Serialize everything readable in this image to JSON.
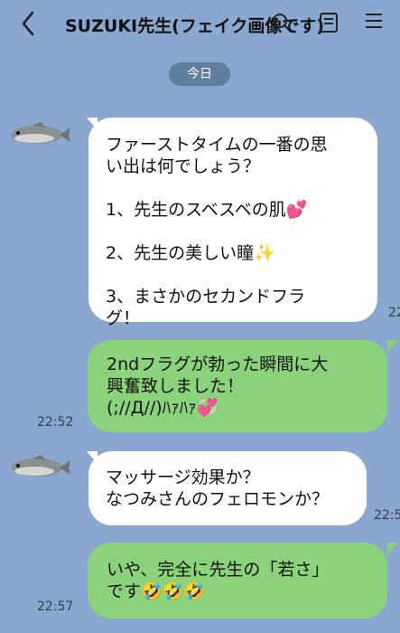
{
  "header": {
    "title": "SUZUKI先生(フェイク画像です)"
  },
  "date_label": "今日",
  "messages": [
    {
      "side": "in",
      "lines": [
        "ファーストタイムの一番の思",
        "い出は何でしょう？",
        "",
        "1、先生のスベスベの肌💕",
        "",
        "2、先生の美しい瞳✨",
        "",
        "3、まさかのセカンドフラ",
        "グ！"
      ],
      "time": "22"
    },
    {
      "side": "out",
      "lines": [
        "2ndフラグが勃った瞬間に大",
        "興奮致しました！",
        "(;//Д//)ﾊｧﾊｧ💞"
      ],
      "time": "22:52"
    },
    {
      "side": "in",
      "lines": [
        "マッサージ効果か？",
        "なつみさんのフェロモンか？"
      ],
      "time": "22:5"
    },
    {
      "side": "out",
      "lines": [
        "いや、完全に先生の「若さ」",
        "です🤣🤣🤣"
      ],
      "time": "22:57"
    }
  ]
}
